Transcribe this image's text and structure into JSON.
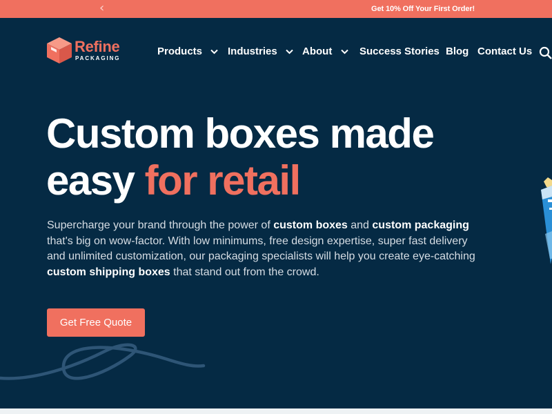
{
  "promo": {
    "prev_arrow": "‹",
    "text": "Get 10% Off Your First Order!"
  },
  "brand": {
    "name": "Refine",
    "sub": "PACKAGING"
  },
  "nav": {
    "products": "Products",
    "industries": "Industries",
    "about": "About",
    "success_stories": "Success Stories",
    "blog": "Blog",
    "contact": "Contact Us"
  },
  "hero": {
    "title_white": "Custom boxes made easy",
    "title_accent": "for retail",
    "desc": {
      "p1": "Supercharge your brand through the power of ",
      "b1": "custom boxes",
      "p2": " and ",
      "b2": "custom packaging",
      "p3": " that's big on wow-factor. With low minimums, free design expertise, super fast delivery and unlimited customization, our packaging specialists will help you create eye-catching ",
      "b3": "custom shipping boxes",
      "p4": " that stand out from the crowd."
    },
    "cta": "Get Free Quote"
  },
  "colors": {
    "background": "#052a44",
    "accent": "#f0705f",
    "text": "#ffffff"
  }
}
